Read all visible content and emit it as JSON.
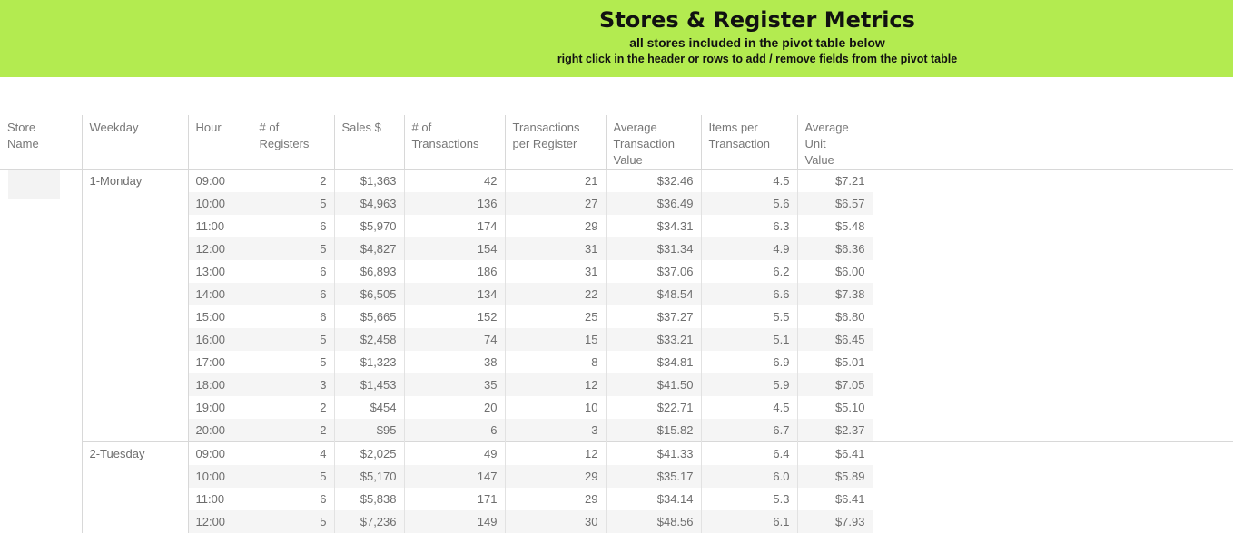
{
  "header": {
    "title": "Stores & Register Metrics",
    "subtitle": "all stores included in the pivot table below",
    "hint": "right click in the header or rows to add / remove fields from the pivot table"
  },
  "colors": {
    "banner": "#b3eb50",
    "row_alt": "#f5f5f5",
    "grid": "#d8d8d8"
  },
  "columns": [
    {
      "line1": "Store",
      "line2": "Name",
      "line3": ""
    },
    {
      "line1": "Weekday",
      "line2": "",
      "line3": ""
    },
    {
      "line1": "Hour",
      "line2": "",
      "line3": ""
    },
    {
      "line1": "# of",
      "line2": "Registers",
      "line3": ""
    },
    {
      "line1": "Sales $",
      "line2": "",
      "line3": ""
    },
    {
      "line1": "# of",
      "line2": "Transactions",
      "line3": ""
    },
    {
      "line1": "Transactions",
      "line2": "per Register",
      "line3": ""
    },
    {
      "line1": "Average",
      "line2": "Transaction",
      "line3": "Value"
    },
    {
      "line1": "Items per",
      "line2": "Transaction",
      "line3": ""
    },
    {
      "line1": "Average",
      "line2": "Unit",
      "line3": "Value"
    }
  ],
  "groups": [
    {
      "weekday": "1-Monday",
      "rows": [
        [
          "09:00",
          "2",
          "$1,363",
          "42",
          "21",
          "$32.46",
          "4.5",
          "$7.21"
        ],
        [
          "10:00",
          "5",
          "$4,963",
          "136",
          "27",
          "$36.49",
          "5.6",
          "$6.57"
        ],
        [
          "11:00",
          "6",
          "$5,970",
          "174",
          "29",
          "$34.31",
          "6.3",
          "$5.48"
        ],
        [
          "12:00",
          "5",
          "$4,827",
          "154",
          "31",
          "$31.34",
          "4.9",
          "$6.36"
        ],
        [
          "13:00",
          "6",
          "$6,893",
          "186",
          "31",
          "$37.06",
          "6.2",
          "$6.00"
        ],
        [
          "14:00",
          "6",
          "$6,505",
          "134",
          "22",
          "$48.54",
          "6.6",
          "$7.38"
        ],
        [
          "15:00",
          "6",
          "$5,665",
          "152",
          "25",
          "$37.27",
          "5.5",
          "$6.80"
        ],
        [
          "16:00",
          "5",
          "$2,458",
          "74",
          "15",
          "$33.21",
          "5.1",
          "$6.45"
        ],
        [
          "17:00",
          "5",
          "$1,323",
          "38",
          "8",
          "$34.81",
          "6.9",
          "$5.01"
        ],
        [
          "18:00",
          "3",
          "$1,453",
          "35",
          "12",
          "$41.50",
          "5.9",
          "$7.05"
        ],
        [
          "19:00",
          "2",
          "$454",
          "20",
          "10",
          "$22.71",
          "4.5",
          "$5.10"
        ],
        [
          "20:00",
          "2",
          "$95",
          "6",
          "3",
          "$15.82",
          "6.7",
          "$2.37"
        ]
      ]
    },
    {
      "weekday": "2-Tuesday",
      "rows": [
        [
          "09:00",
          "4",
          "$2,025",
          "49",
          "12",
          "$41.33",
          "6.4",
          "$6.41"
        ],
        [
          "10:00",
          "5",
          "$5,170",
          "147",
          "29",
          "$35.17",
          "6.0",
          "$5.89"
        ],
        [
          "11:00",
          "6",
          "$5,838",
          "171",
          "29",
          "$34.14",
          "5.3",
          "$6.41"
        ],
        [
          "12:00",
          "5",
          "$7,236",
          "149",
          "30",
          "$48.56",
          "6.1",
          "$7.93"
        ]
      ]
    }
  ]
}
